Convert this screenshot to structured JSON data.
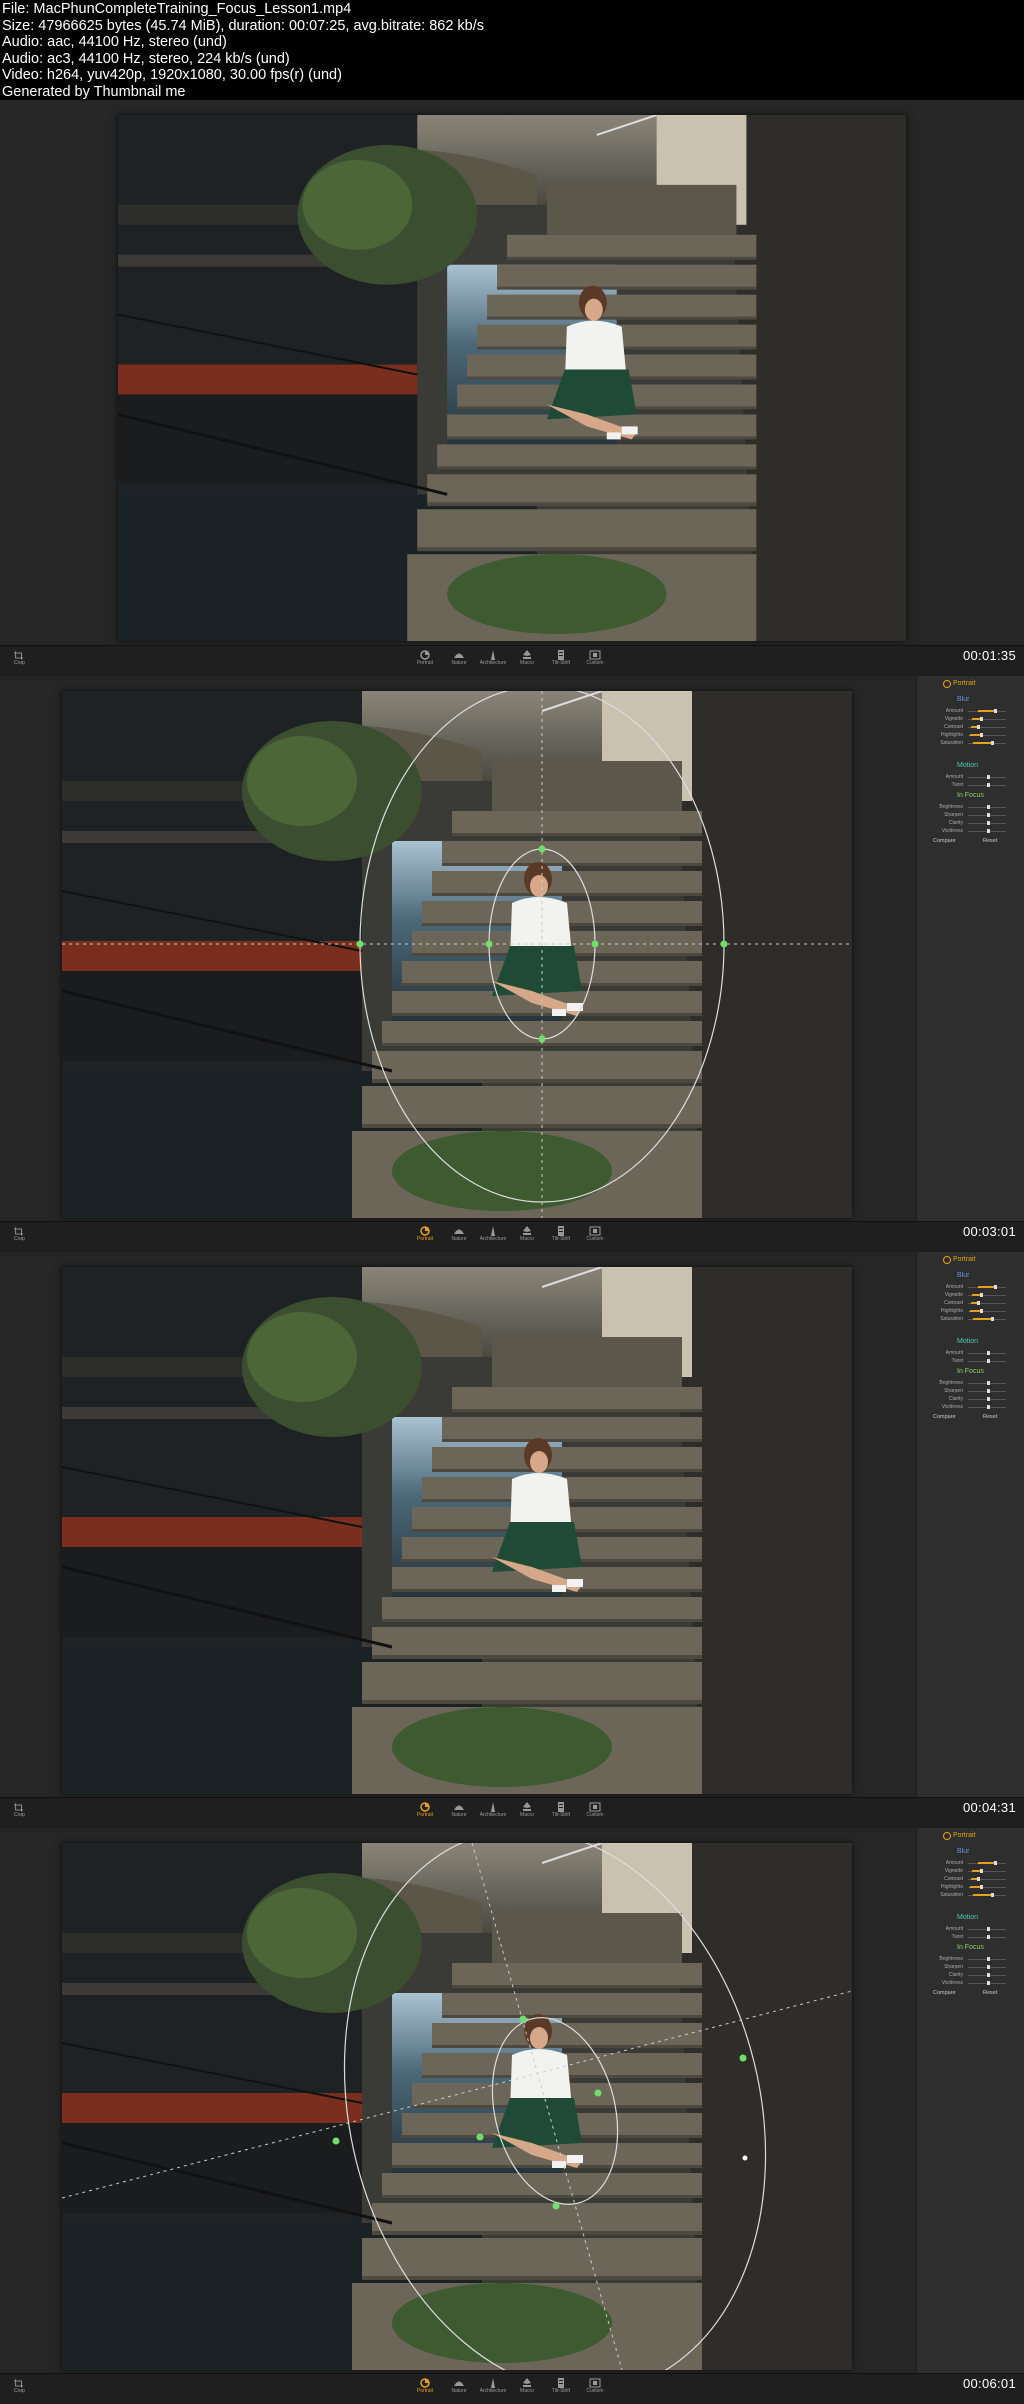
{
  "info": {
    "line1": "File: MacPhunCompleteTraining_Focus_Lesson1.mp4",
    "line2": "Size: 47966625 bytes (45.74 MiB), duration: 00:07:25, avg.bitrate: 862 kb/s",
    "line3": "Audio: aac, 44100 Hz, stereo (und)",
    "line4": "Audio: ac3, 44100 Hz, stereo, 224 kb/s (und)",
    "line5": "Video: h264, yuv420p, 1920x1080, 30.00 fps(r) (und)",
    "line6": "Generated by Thumbnail me"
  },
  "frames": [
    {
      "timestamp": "00:01:35"
    },
    {
      "timestamp": "00:03:01"
    },
    {
      "timestamp": "00:04:31"
    },
    {
      "timestamp": "00:06:01"
    }
  ],
  "toolbar": {
    "crop": "Crop",
    "tools": [
      "Portrait",
      "Nature",
      "Architecture",
      "Macro",
      "Tilt-Shift",
      "Custom"
    ]
  },
  "panel": {
    "title": "Portrait",
    "blur_title": "Blur",
    "blur_rows": [
      "Amount",
      "Vignette",
      "Contrast",
      "Highlights",
      "Saturation"
    ],
    "motion_title": "Motion",
    "motion_rows": [
      "Amount",
      "Twist"
    ],
    "focus_title": "In Focus",
    "focus_rows": [
      "Brightness",
      "Sharpen",
      "Clarity",
      "Vividness"
    ],
    "compare": "Compare",
    "reset": "Reset"
  },
  "colors": {
    "accent": "#e3a21a",
    "blur": "#6d8fd8",
    "motion": "#5ac8b4",
    "focus": "#8fd060"
  }
}
